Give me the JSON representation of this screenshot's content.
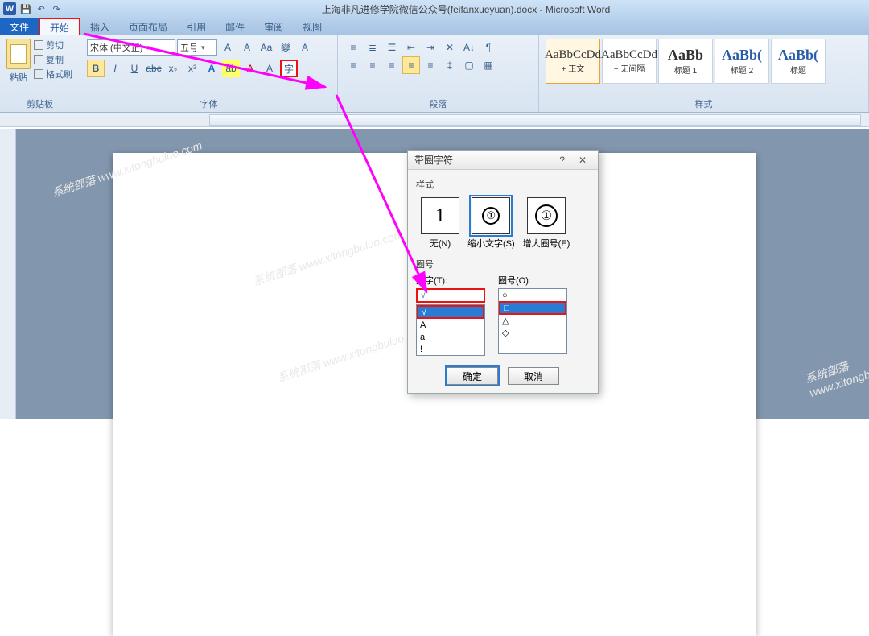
{
  "app": {
    "title": "上海非凡进修学院微信公众号(feifanxueyuan).docx - Microsoft Word"
  },
  "qat": {
    "save": "💾",
    "undo": "↶",
    "redo": "↷"
  },
  "tabs": {
    "file": "文件",
    "home": "开始",
    "insert": "插入",
    "layout": "页面布局",
    "ref": "引用",
    "mail": "邮件",
    "review": "审阅",
    "view": "视图"
  },
  "clipboard": {
    "paste": "粘贴",
    "cut": "剪切",
    "copy": "复制",
    "fmt": "格式刷",
    "label": "剪贴板"
  },
  "font": {
    "family": "宋体 (中文正)",
    "size": "五号",
    "grow": "A",
    "shrink": "A",
    "case": "Aa",
    "phonetic": "變",
    "clear": "A",
    "bold": "B",
    "italic": "I",
    "underline": "U",
    "strike": "abc",
    "sub": "x₂",
    "sup": "x²",
    "texteffect": "A",
    "highlight": "ab",
    "fontcolor": "A",
    "charshade": "A",
    "enclosed": "字",
    "label": "字体"
  },
  "para": {
    "label": "段落"
  },
  "styles": {
    "label": "样式",
    "items": [
      {
        "preview": "AaBbCcDd",
        "name": "+ 正文"
      },
      {
        "preview": "AaBbCcDd",
        "name": "+ 无间隔"
      },
      {
        "preview": "AaBb",
        "name": "标题 1"
      },
      {
        "preview": "AaBb(",
        "name": "标题 2"
      },
      {
        "preview": "AaBb(",
        "name": "标题"
      }
    ]
  },
  "dialog": {
    "title": "带圈字符",
    "help": "?",
    "close": "✕",
    "sec_style": "样式",
    "opt_none": "无(N)",
    "opt_shrink": "缩小文字(S)",
    "opt_enlarge": "增大圈号(E)",
    "none_glyph": "1",
    "shrink_glyph": "①",
    "enlarge_glyph": "①",
    "sec_ring": "圈号",
    "lbl_text": "文字(T):",
    "lbl_ring": "圈号(O):",
    "text_input": "√",
    "text_list": [
      "√",
      "A",
      "a",
      "!"
    ],
    "ring_list": [
      "○",
      "□",
      "△",
      "◇"
    ],
    "ok": "确定",
    "cancel": "取消"
  },
  "watermark": "系统部落 www.xitongbuluo.com"
}
